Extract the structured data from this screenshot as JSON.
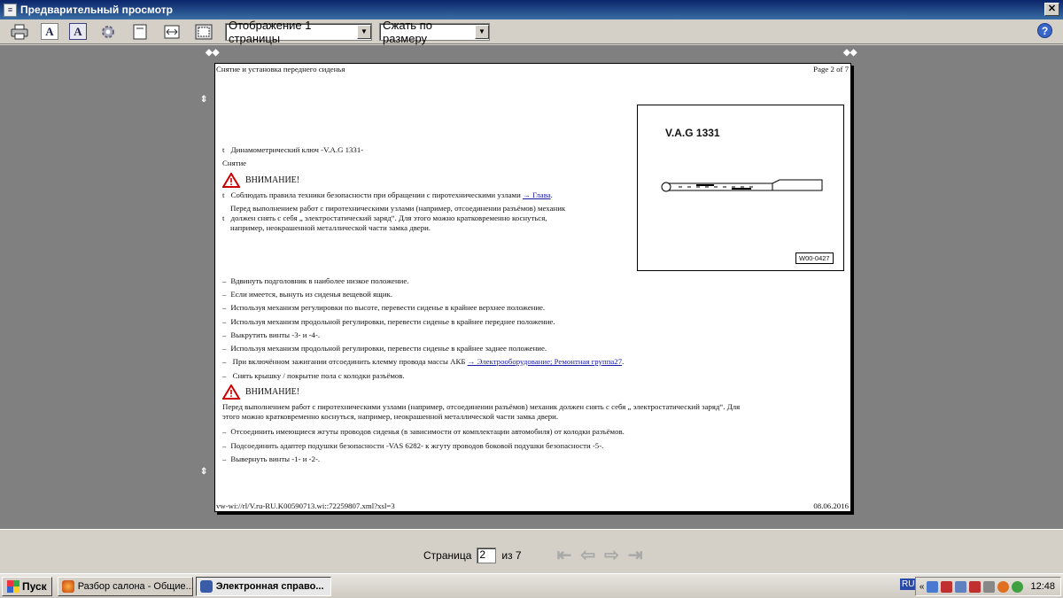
{
  "window": {
    "title": "Предварительный просмотр"
  },
  "toolbar": {
    "page_mode": "Отображение 1 страницы",
    "zoom_mode": "Сжать по размеру",
    "icons": [
      "printer-icon",
      "portrait-icon",
      "landscape-icon",
      "settings-icon",
      "page-setup-icon",
      "fit-width-icon",
      "fit-page-icon"
    ]
  },
  "document": {
    "header_left": "Снятие и установка переднего сиденья",
    "header_right": "Page 2 of 7",
    "footer_left": "vw-wi://rl/V.ru-RU.K00590713.wi::72259807.xml?xsl=3",
    "footer_right": "08.06.2016",
    "tool_line": "Динамометрический ключ -V.A.G 1331-",
    "section_removal": "Снятие",
    "warning_label": "ВНИМАНИЕ!",
    "warn1_text": "Соблюдать правила техники безопасности при обращении с пиротехническими узлами",
    "warn1_link": "→ Глава",
    "warn1_end": ".",
    "warn2_line1": "Перед выполнением работ с пиротехническими узлами (например, отсоединении разъёмов) механик",
    "warn2_line2": "должен снять с себя „ электростатический заряд“. Для этого можно кратковременно коснуться,",
    "warn2_line3": "например, неокрашенной металлической части замка двери.",
    "bullet_marker": "t",
    "dash": "–",
    "steps": [
      "Вдвинуть подголовник в наиболее низкое положение.",
      "Если имеется, вынуть из сиденья вещевой ящик.",
      "Используя механизм регулировки по высоте, перевести сиденье в крайнее верхнее положение.",
      "Используя механизм продольной регулировки, перевести сиденье в крайнее переднее положение.",
      "Выкрутить винты -3- и -4-.",
      "Используя механизм продольной регулировки, перевести сиденье в крайнее заднее положение."
    ],
    "step_akb": "При включённом зажигании отсоединить клемму провода массы АКБ",
    "step_akb_link": "→ Электрооборудование; Ремонтная группа27",
    "step_akb_end": ".",
    "step_cover": "Снять крышку / покрытие пола с колодки разъёмов.",
    "warn3_line1": "Перед выполнением работ с пиротехническими узлами (например, отсоединении разъёмов) механик должен снять с себя „ электростатический заряд“. Для",
    "warn3_line2": "этого можно кратковременно коснуться, например, неокрашенной металлической части замка двери.",
    "steps2": [
      "Отсоединить имеющиеся жгуты проводов сиденья (в зависимости от комплектации автомобиля) от колодки разъёмов.",
      "Подсоединить адаптер подушки безопасности -VAS 6282- к жгуту проводов боковой подушки безопасности -5-.",
      "Вывернуть винты -1- и -2-."
    ],
    "figure_title": "V.A.G 1331",
    "figure_code": "W00-0427"
  },
  "pager": {
    "label": "Страница",
    "current": "2",
    "of": "из 7"
  },
  "taskbar": {
    "start": "Пуск",
    "task1": "Разбор салона - Общие...",
    "task2": "Электронная справо...",
    "lang": "RU",
    "clock": "12:48"
  }
}
